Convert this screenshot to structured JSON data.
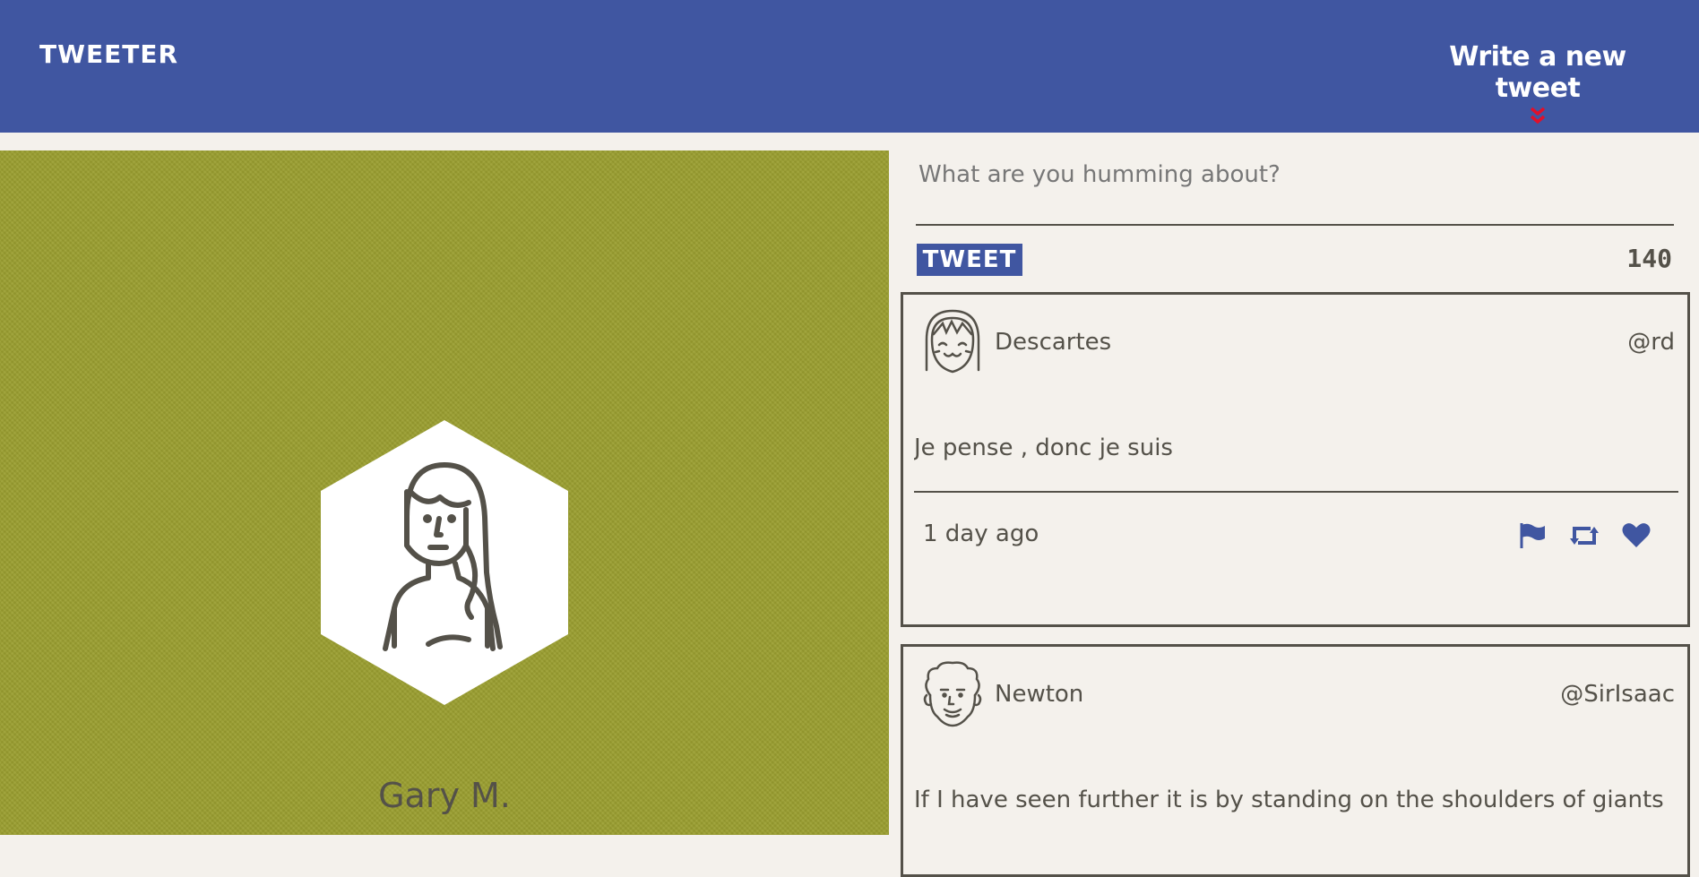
{
  "nav": {
    "brand": "TWEETER",
    "compose_toggle_label": "Write a new tweet"
  },
  "profile": {
    "name": "Gary M."
  },
  "composer": {
    "placeholder": "What are you humming about?",
    "value": "",
    "button_label": "TWEET",
    "counter": "140"
  },
  "tweets": [
    {
      "author": "Descartes",
      "handle": "@rd",
      "text": "Je pense , donc je suis",
      "time": "1 day ago",
      "actions": [
        "flag-icon",
        "retweet-icon",
        "heart-icon"
      ]
    },
    {
      "author": "Newton",
      "handle": "@SirIsaac",
      "text": "If I have seen further it is by standing on the shoulders of giants"
    }
  ],
  "colors": {
    "nav_bg": "#4056a1",
    "profile_bg": "#9a9e2f",
    "page_bg": "#f4f1ec",
    "text": "#545149",
    "chevron": "#e0102b"
  }
}
